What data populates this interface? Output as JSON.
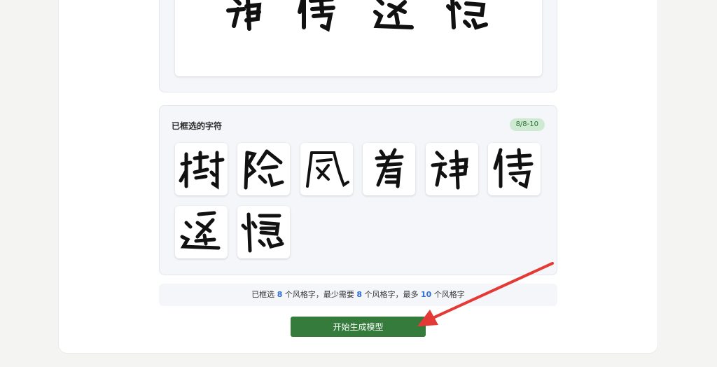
{
  "preview": {
    "glyphs": [
      "神",
      "侍",
      "逢",
      "憶"
    ]
  },
  "selected": {
    "title": "已框选的字符",
    "badge": "8/8-10",
    "chars": [
      "樹",
      "陰",
      "風",
      "着",
      "神",
      "侍",
      "逢",
      "憶"
    ]
  },
  "info": {
    "prefix": "已框选",
    "count": "8",
    "part1": "个风格字，最少需要",
    "min": "8",
    "part2": "个风格字，最多",
    "max": "10",
    "part3": "个风格字"
  },
  "actions": {
    "start_label": "开始生成模型"
  },
  "colors": {
    "accent_green": "#347b3c",
    "badge_bg": "#cfead2",
    "number_blue": "#2f6fd0",
    "arrow_red": "#e53935"
  }
}
